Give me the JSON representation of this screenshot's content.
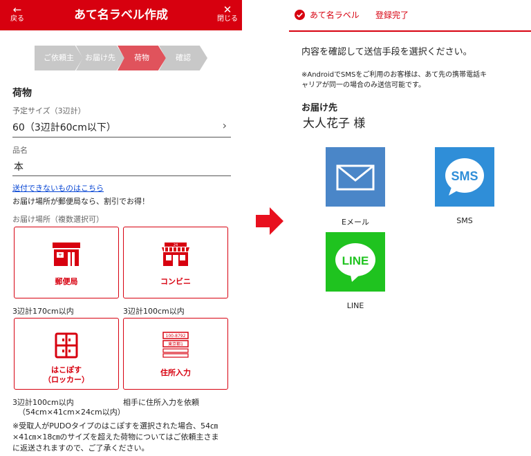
{
  "left": {
    "header": {
      "back_label": "戻る",
      "title": "あて名ラベル作成",
      "close_label": "閉じる"
    },
    "steps": [
      "ご依頼主",
      "お届け先",
      "荷物",
      "確認"
    ],
    "section_title": "荷物",
    "size": {
      "label": "予定サイズ（3辺計）",
      "value": "60（3辺計60cm以下）"
    },
    "item": {
      "label": "品名",
      "value": "本"
    },
    "link": "送付できないものはこちら",
    "discount_note": "お届け場所が郵便局なら、割引でお得！",
    "location_label": "お届け場所（複数選択可）",
    "options": [
      {
        "label": "郵便局",
        "note": "3辺計170cm以内"
      },
      {
        "label": "コンビニ",
        "note": "3辺計100cm以内"
      },
      {
        "label_line1": "はこぽす",
        "label_line2": "（ロッカー）",
        "note_line1": "3辺計100cm以内",
        "note_line2": "（54cm×41cm×24cm以内）"
      },
      {
        "label": "住所入力",
        "note": "相手に住所入力を依頼",
        "card_line1": "100-8792",
        "card_line2": "東京都1"
      }
    ],
    "footnote_line1": "※受取人がPUDOタイプのはこぽすを選択された場合、54㎝",
    "footnote_line2": "×41㎝×18㎝のサイズを超えた荷物についてはご依頼主さま",
    "footnote_line3": "に返送されますので、ご了承ください。"
  },
  "right": {
    "header": {
      "title": "あて名ラベル",
      "status": "登録完了"
    },
    "instruction": "内容を確認して送信手段を選択ください。",
    "note_line1": "※AndroidでSMSをご利用のお客様は、あて先の携帯電話キ",
    "note_line2": "ャリアが同一の場合のみ送信可能です。",
    "recipient_label": "お届け先",
    "recipient_name": "大人花子 様",
    "methods": [
      {
        "label": "Eメール",
        "icon": "envelope-icon",
        "color": "#4a86c8"
      },
      {
        "label": "SMS",
        "icon": "sms-bubble-icon",
        "color": "#2f8ed8",
        "badge": "SMS"
      },
      {
        "label": "LINE",
        "icon": "line-bubble-icon",
        "color": "#1fc31f",
        "badge": "LINE"
      }
    ]
  },
  "colors": {
    "accent": "#d7000f",
    "step_inactive": "#c8c8c8",
    "step_active": "#e0535c"
  }
}
